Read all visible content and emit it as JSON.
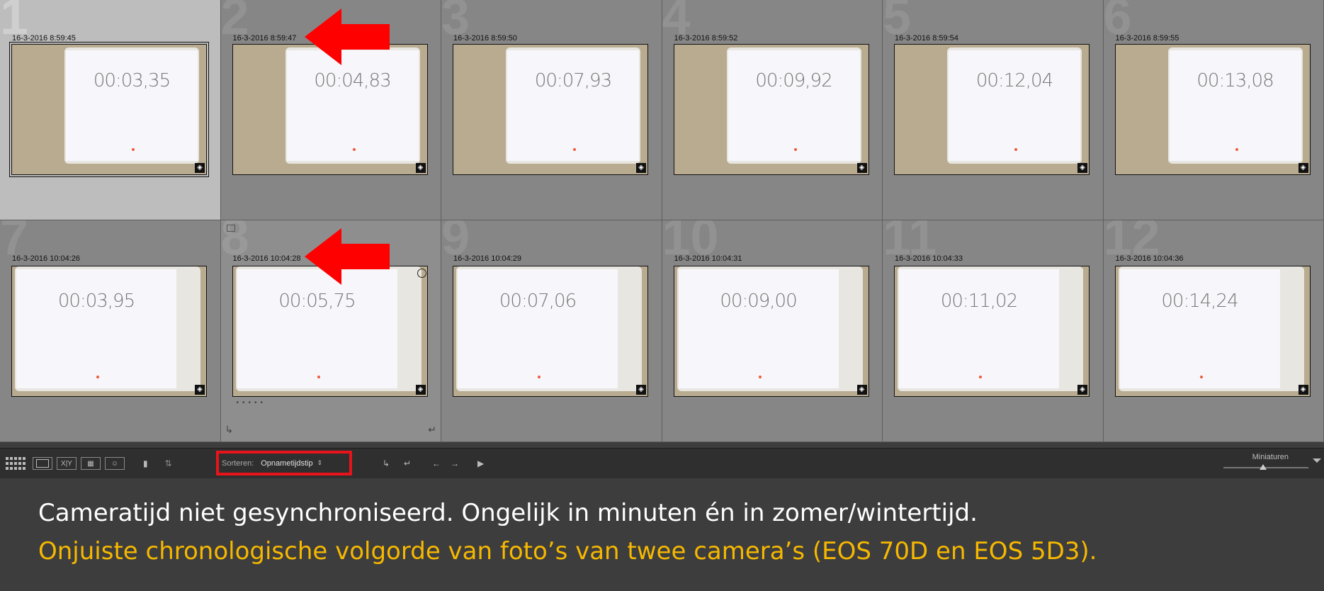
{
  "grid": {
    "cells": [
      {
        "num": "1",
        "time": "16-3-2016 8:59:45",
        "stopwatch": "00:03,35"
      },
      {
        "num": "2",
        "time": "16-3-2016 8:59:47",
        "stopwatch": "00:04,83"
      },
      {
        "num": "3",
        "time": "16-3-2016 8:59:50",
        "stopwatch": "00:07,93"
      },
      {
        "num": "4",
        "time": "16-3-2016 8:59:52",
        "stopwatch": "00:09,92"
      },
      {
        "num": "5",
        "time": "16-3-2016 8:59:54",
        "stopwatch": "00:12,04"
      },
      {
        "num": "6",
        "time": "16-3-2016 8:59:55",
        "stopwatch": "00:13,08"
      },
      {
        "num": "7",
        "time": "16-3-2016 10:04:26",
        "stopwatch": "00:03,95"
      },
      {
        "num": "8",
        "time": "16-3-2016 10:04:28",
        "stopwatch": "00:05,75"
      },
      {
        "num": "9",
        "time": "16-3-2016 10:04:29",
        "stopwatch": "00:07,06"
      },
      {
        "num": "10",
        "time": "16-3-2016 10:04:31",
        "stopwatch": "00:09,00"
      },
      {
        "num": "11",
        "time": "16-3-2016 10:04:33",
        "stopwatch": "00:11,02"
      },
      {
        "num": "12",
        "time": "16-3-2016 10:04:36",
        "stopwatch": "00:14,24"
      }
    ]
  },
  "toolbar": {
    "sort_label": "Sorteren:",
    "sort_value": "Opnametijdstip",
    "thumb_size_label": "Miniaturen",
    "thumb_size_level": 0.47,
    "compare_label": "X|Y",
    "highlight_color": "#e8131b"
  },
  "caption": {
    "line1": "Cameratijd niet gesynchroniseerd. Ongelijk in minuten én in zomer/wintertijd.",
    "line2": "Onjuiste chronologische volgorde van foto’s van twee camera’s (EOS 70D en EOS 5D3).",
    "line1_color": "#ffffff",
    "line2_color": "#f6b800"
  },
  "annotations": {
    "arrow_color": "#ff0000"
  }
}
